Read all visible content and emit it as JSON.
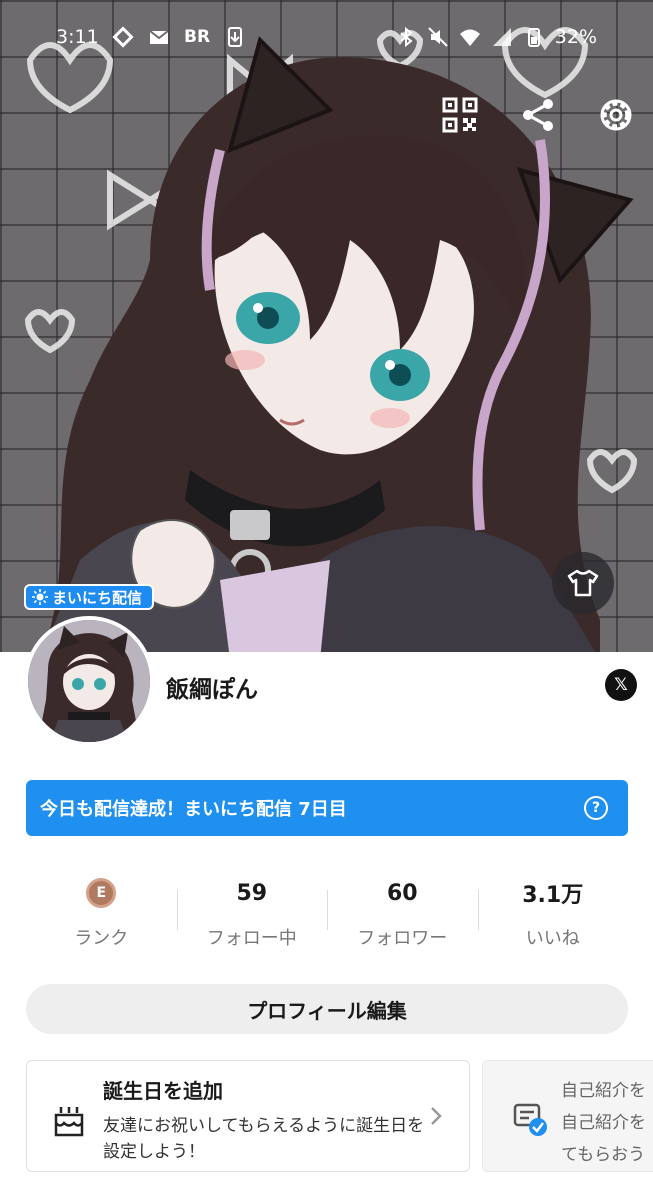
{
  "status_bar": {
    "time": "3:11",
    "left_icons": [
      "diamond-icon",
      "mail-icon",
      "br-icon",
      "download-icon"
    ],
    "br_text": "BR",
    "right_icons": [
      "bluetooth-icon",
      "mute-icon",
      "wifi-icon",
      "signal-icon",
      "battery-icon"
    ],
    "battery": "32%"
  },
  "header_actions": [
    "qr-code-icon",
    "share-icon",
    "settings-gear-icon"
  ],
  "hero": {
    "daily_badge": "まいにち配信",
    "outfit_icon": "tshirt-icon"
  },
  "profile": {
    "username": "飯綱ぽん",
    "social_icon": "x-logo-icon",
    "social_text": "𝕏"
  },
  "banner": {
    "text": "今日も配信達成！まいにち配信 7日目",
    "help_glyph": "?"
  },
  "stats": [
    {
      "value": "E",
      "label": "ランク"
    },
    {
      "value": "59",
      "label": "フォロー中"
    },
    {
      "value": "60",
      "label": "フォロワー"
    },
    {
      "value": "3.1万",
      "label": "いいね"
    }
  ],
  "edit_profile_label": "プロフィール編集",
  "cards": [
    {
      "title": "誕生日を追加",
      "body": "友達にお祝いしてもらえるように誕生日を設定しよう！",
      "icon": "cake-icon"
    },
    {
      "line1": "自己紹介を",
      "line2": "自己紹介を",
      "line3": "てもらおう",
      "icon": "profile-check-icon"
    }
  ],
  "colors": {
    "accent_blue": "#1f8ff0",
    "rank_bronze": "#b07a60",
    "edit_button_bg": "#eeeeee"
  }
}
